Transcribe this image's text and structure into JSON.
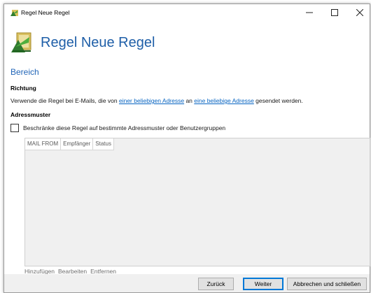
{
  "window": {
    "title": "Regel Neue Regel"
  },
  "header": {
    "title": "Regel Neue Regel"
  },
  "bereich": {
    "heading": "Bereich"
  },
  "richtung": {
    "label": "Richtung",
    "text_before": "Verwende die Regel bei E-Mails, die von ",
    "link_sender": "einer beliebigen Adresse",
    "text_middle": " an ",
    "link_recipient": "eine beliebige Adresse",
    "text_after": " gesendet werden."
  },
  "adressmuster": {
    "label": "Adressmuster",
    "checkbox_label": "Beschränke diese Regel auf bestimmte Adressmuster oder Benutzergruppen",
    "checked": false,
    "columns": [
      "MAIL FROM",
      "Empfänger",
      "Status"
    ],
    "actions": {
      "add": "Hinzufügen",
      "edit": "Bearbeiten",
      "remove": "Entfernen"
    }
  },
  "footer": {
    "back": "Zurück",
    "next": "Weiter",
    "cancel": "Abbrechen und schließen"
  },
  "colors": {
    "accent": "#1f5fa8",
    "link": "#0563c1",
    "focus": "#0078d7"
  }
}
